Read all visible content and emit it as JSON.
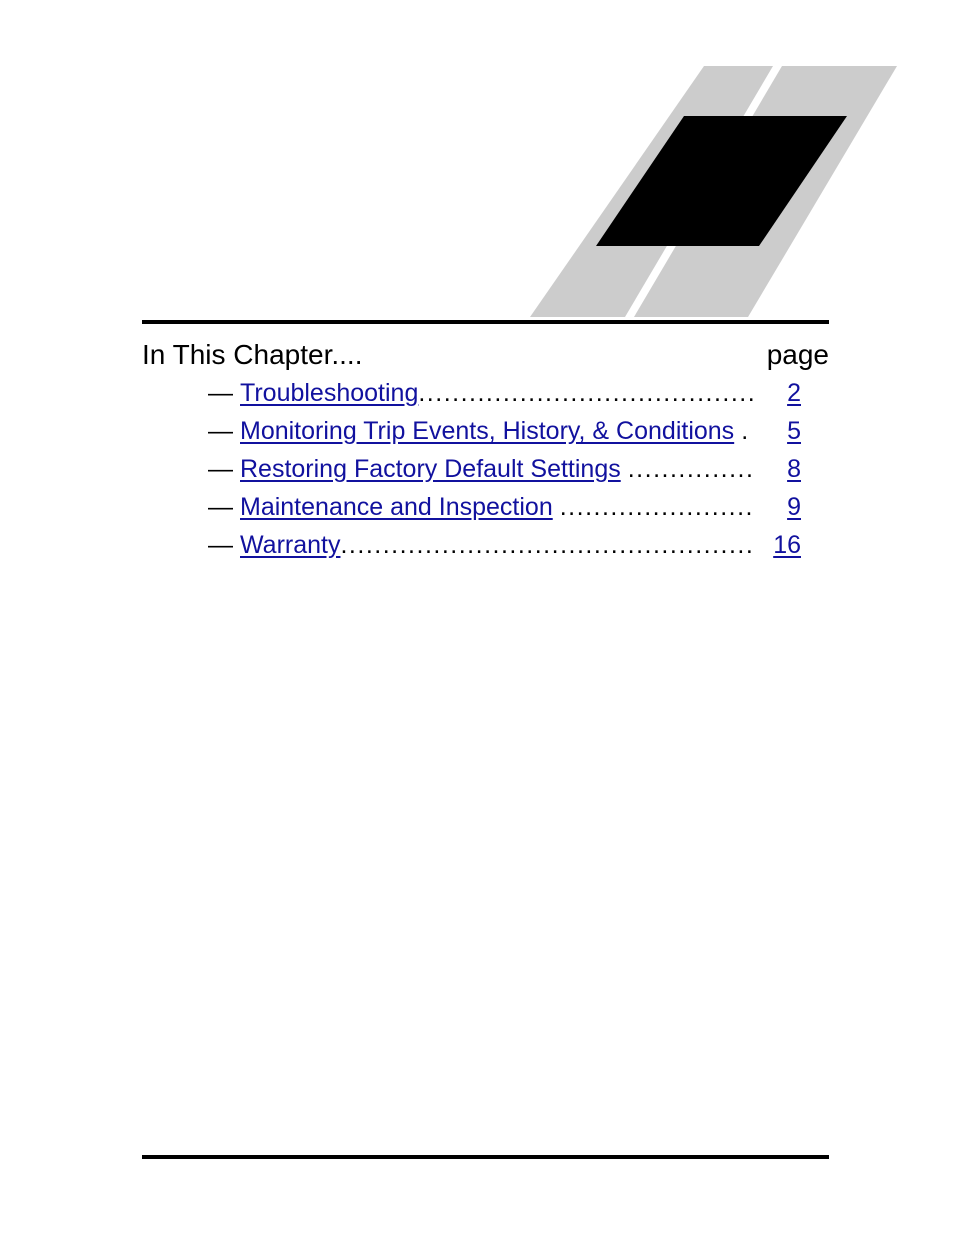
{
  "graphic": {
    "name": "chapter-banner-parallelograms",
    "band_color": "#cccccc",
    "block_color": "#000000"
  },
  "rules": {
    "color": "#000000"
  },
  "heading": {
    "title": "In This Chapter....",
    "page_label": "page"
  },
  "toc": {
    "bullet": "—",
    "link_color": "#11119e",
    "entries": [
      {
        "label": "Troubleshooting",
        "leader": "...............................................",
        "leader_spaced": false,
        "page": "2"
      },
      {
        "label": "Monitoring Trip Events, History, & Conditions",
        "leader": ".",
        "leader_spaced": true,
        "page": "5"
      },
      {
        "label": "Restoring Factory Default Settings",
        "leader": ".................",
        "leader_spaced": true,
        "page": "8"
      },
      {
        "label": "Maintenance and Inspection",
        "leader": "...........................",
        "leader_spaced": true,
        "page": "9"
      },
      {
        "label": "Warranty",
        "leader": "..........................................................",
        "leader_spaced": false,
        "page": "16"
      }
    ]
  }
}
